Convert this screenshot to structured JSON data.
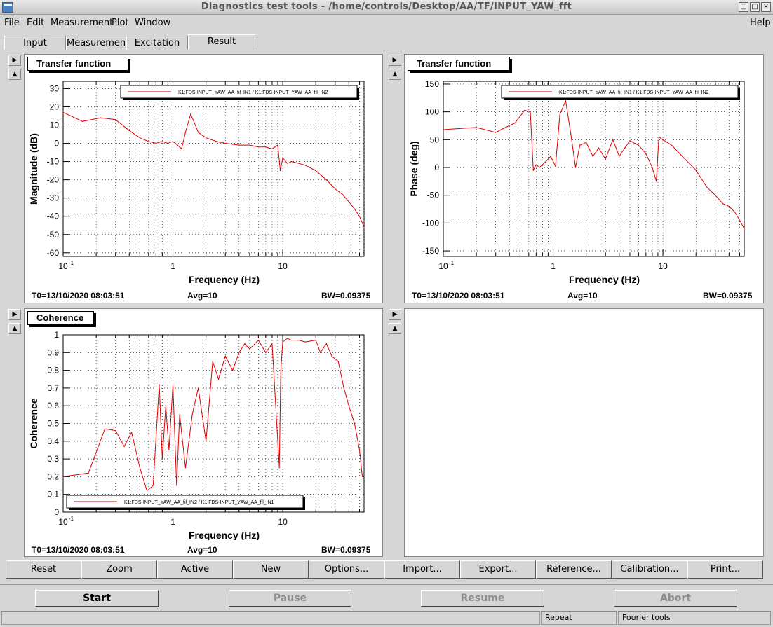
{
  "window": {
    "title": "Diagnostics test tools - /home/controls/Desktop/AA/TF/INPUT_YAW_fft",
    "minimize_glyph": "□",
    "maximize_glyph": "□",
    "close_glyph": "×"
  },
  "menu": {
    "file": "File",
    "edit": "Edit",
    "measurement": "Measurement",
    "plot": "Plot",
    "window": "Window",
    "help": "Help"
  },
  "tabs": [
    "Input",
    "Measurement",
    "Excitation",
    "Result"
  ],
  "active_tab": "Result",
  "panels": {
    "tl": {
      "title": "Transfer function",
      "legend": "K1:FDS-INPUT_YAW_AA_fil_IN1 / K1:FDS-INPUT_YAW_AA_fil_IN2",
      "t0": "T0=13/10/2020 08:03:51",
      "avg": "Avg=10",
      "bw": "BW=0.09375"
    },
    "tr": {
      "title": "Transfer function",
      "legend": "K1:FDS-INPUT_YAW_AA_fil_IN1 / K1:FDS-INPUT_YAW_AA_fil_IN2",
      "t0": "T0=13/10/2020 08:03:51",
      "avg": "Avg=10",
      "bw": "BW=0.09375"
    },
    "bl": {
      "title": "Coherence",
      "legend": "K1:FDS-INPUT_YAW_AA_fil_IN2 / K1:FDS-INPUT_YAW_AA_fil_IN1",
      "t0": "T0=13/10/2020 08:03:51",
      "avg": "Avg=10",
      "bw": "BW=0.09375"
    }
  },
  "chart_data": [
    {
      "type": "line",
      "title": "Transfer function",
      "xlabel": "Frequency (Hz)",
      "ylabel": "Magnitude (dB)",
      "xscale": "log",
      "xlim": [
        0.1,
        55
      ],
      "ylim": [
        -62,
        34
      ],
      "xticks": [
        "10",
        "1",
        "10"
      ],
      "yticks": [
        "30",
        "20",
        "10",
        "0",
        "-10",
        "-20",
        "-30",
        "-40",
        "-50",
        "-60"
      ],
      "grid": true,
      "legend_position": "top-right",
      "color": "#dd0000",
      "x": [
        0.1,
        0.15,
        0.22,
        0.3,
        0.4,
        0.5,
        0.6,
        0.7,
        0.8,
        0.9,
        1.0,
        1.1,
        1.2,
        1.3,
        1.45,
        1.55,
        1.7,
        2.0,
        2.5,
        3,
        4,
        5,
        6,
        7,
        8,
        9,
        9.5,
        10,
        11,
        12,
        14,
        16,
        20,
        25,
        30,
        35,
        40,
        45,
        50,
        55
      ],
      "y": [
        17,
        12,
        14,
        13,
        7,
        3,
        1,
        0,
        1,
        0,
        1,
        -1,
        -3,
        6,
        16,
        12,
        6,
        3,
        1,
        0,
        -1,
        -1,
        -2,
        -2,
        -3,
        -1,
        -15,
        -8,
        -11,
        -10,
        -11,
        -12,
        -15,
        -20,
        -25,
        -28,
        -32,
        -36,
        -40,
        -46
      ],
      "series": [
        {
          "name": "K1:FDS-INPUT_YAW_AA_fil_IN1 / K1:FDS-INPUT_YAW_AA_fil_IN2"
        }
      ]
    },
    {
      "type": "line",
      "title": "Transfer function",
      "xlabel": "Frequency (Hz)",
      "ylabel": "Phase (deg)",
      "xscale": "log",
      "xlim": [
        0.1,
        55
      ],
      "ylim": [
        -160,
        155
      ],
      "xticks": [
        "10",
        "1",
        "10"
      ],
      "yticks": [
        "150",
        "100",
        "50",
        "0",
        "-50",
        "-100",
        "-150"
      ],
      "grid": true,
      "legend_position": "top-right",
      "color": "#dd0000",
      "x": [
        0.1,
        0.2,
        0.3,
        0.35,
        0.45,
        0.55,
        0.62,
        0.66,
        0.7,
        0.75,
        0.85,
        0.95,
        1.05,
        1.15,
        1.3,
        1.45,
        1.6,
        1.75,
        2.0,
        2.3,
        2.6,
        3,
        3.5,
        4,
        4.5,
        5,
        6,
        7,
        8,
        8.7,
        9.2,
        10,
        12,
        15,
        20,
        25,
        30,
        35,
        40,
        45,
        50,
        55
      ],
      "y": [
        68,
        72,
        63,
        70,
        80,
        103,
        100,
        -5,
        5,
        0,
        10,
        20,
        2,
        95,
        120,
        60,
        0,
        40,
        45,
        20,
        35,
        15,
        50,
        20,
        35,
        48,
        40,
        25,
        0,
        -25,
        55,
        50,
        40,
        20,
        -5,
        -35,
        -50,
        -65,
        -70,
        -80,
        -95,
        -110
      ],
      "series": [
        {
          "name": "K1:FDS-INPUT_YAW_AA_fil_IN1 / K1:FDS-INPUT_YAW_AA_fil_IN2"
        }
      ]
    },
    {
      "type": "line",
      "title": "Coherence",
      "xlabel": "Frequency (Hz)",
      "ylabel": "Coherence",
      "xscale": "log",
      "xlim": [
        0.1,
        55
      ],
      "ylim": [
        0,
        1
      ],
      "xticks": [
        "10",
        "1",
        "10"
      ],
      "yticks": [
        "1",
        "0.9",
        "0.8",
        "0.7",
        "0.6",
        "0.5",
        "0.4",
        "0.3",
        "0.2",
        "0.1",
        "0"
      ],
      "grid": true,
      "legend_position": "bottom-center",
      "color": "#dd0000",
      "x": [
        0.1,
        0.17,
        0.24,
        0.3,
        0.36,
        0.42,
        0.5,
        0.58,
        0.66,
        0.75,
        0.8,
        0.86,
        0.92,
        1.0,
        1.08,
        1.15,
        1.3,
        1.5,
        1.7,
        2.0,
        2.3,
        2.6,
        3,
        3.5,
        4,
        4.5,
        5,
        6,
        7,
        8,
        9.3,
        9.6,
        10,
        11,
        12,
        14,
        16,
        20,
        22,
        25,
        28,
        32,
        36,
        40,
        45,
        50,
        53
      ],
      "y": [
        0.2,
        0.22,
        0.47,
        0.46,
        0.37,
        0.45,
        0.25,
        0.12,
        0.15,
        0.72,
        0.3,
        0.6,
        0.35,
        0.72,
        0.15,
        0.55,
        0.25,
        0.55,
        0.7,
        0.4,
        0.85,
        0.75,
        0.88,
        0.8,
        0.9,
        0.95,
        0.92,
        0.97,
        0.9,
        0.95,
        0.25,
        0.8,
        0.96,
        0.98,
        0.97,
        0.97,
        0.96,
        0.97,
        0.9,
        0.95,
        0.88,
        0.85,
        0.7,
        0.6,
        0.5,
        0.35,
        0.2
      ],
      "series": [
        {
          "name": "K1:FDS-INPUT_YAW_AA_fil_IN2 / K1:FDS-INPUT_YAW_AA_fil_IN1"
        }
      ]
    }
  ],
  "buttons": [
    "Reset",
    "Zoom",
    "Active",
    "New",
    "Options...",
    "Import...",
    "Export...",
    "Reference...",
    "Calibration...",
    "Print..."
  ],
  "controls": {
    "start": "Start",
    "pause": "Pause",
    "resume": "Resume",
    "abort": "Abort"
  },
  "status": {
    "repeat": "Repeat",
    "fourier": "Fourier tools"
  },
  "side_glyphs": {
    "right": "▶",
    "up": "▲"
  }
}
